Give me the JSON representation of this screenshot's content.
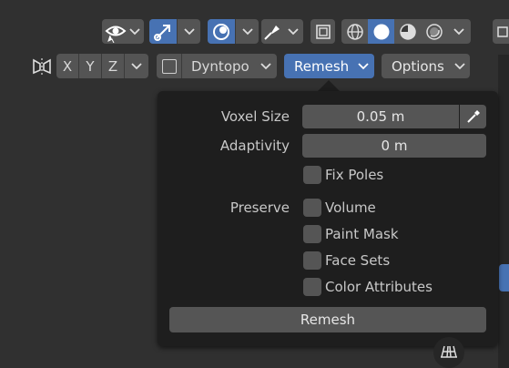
{
  "header": {
    "row1": {
      "icons": [
        "eye-icon",
        "gizmo-icon",
        "overlay-icon",
        "xray-icon",
        "wireframe-icon",
        "solid-icon",
        "material-preview-icon",
        "rendered-icon"
      ]
    },
    "row2": {
      "mirror_icon": "mirror-icon",
      "axes": [
        "X",
        "Y",
        "Z"
      ],
      "dyntopo_label": "Dyntopo",
      "remesh_label": "Remesh",
      "options_label": "Options",
      "active_color": "#4772b3"
    }
  },
  "popover": {
    "voxel_size_label": "Voxel Size",
    "voxel_size_value": "0.05 m",
    "adaptivity_label": "Adaptivity",
    "adaptivity_value": "0 m",
    "fix_poles_label": "Fix Poles",
    "preserve_label": "Preserve",
    "preserve_options": [
      "Volume",
      "Paint Mask",
      "Face Sets",
      "Color Attributes"
    ],
    "remesh_button": "Remesh"
  },
  "sidebar": {
    "icons": [
      "grid-icon"
    ]
  }
}
